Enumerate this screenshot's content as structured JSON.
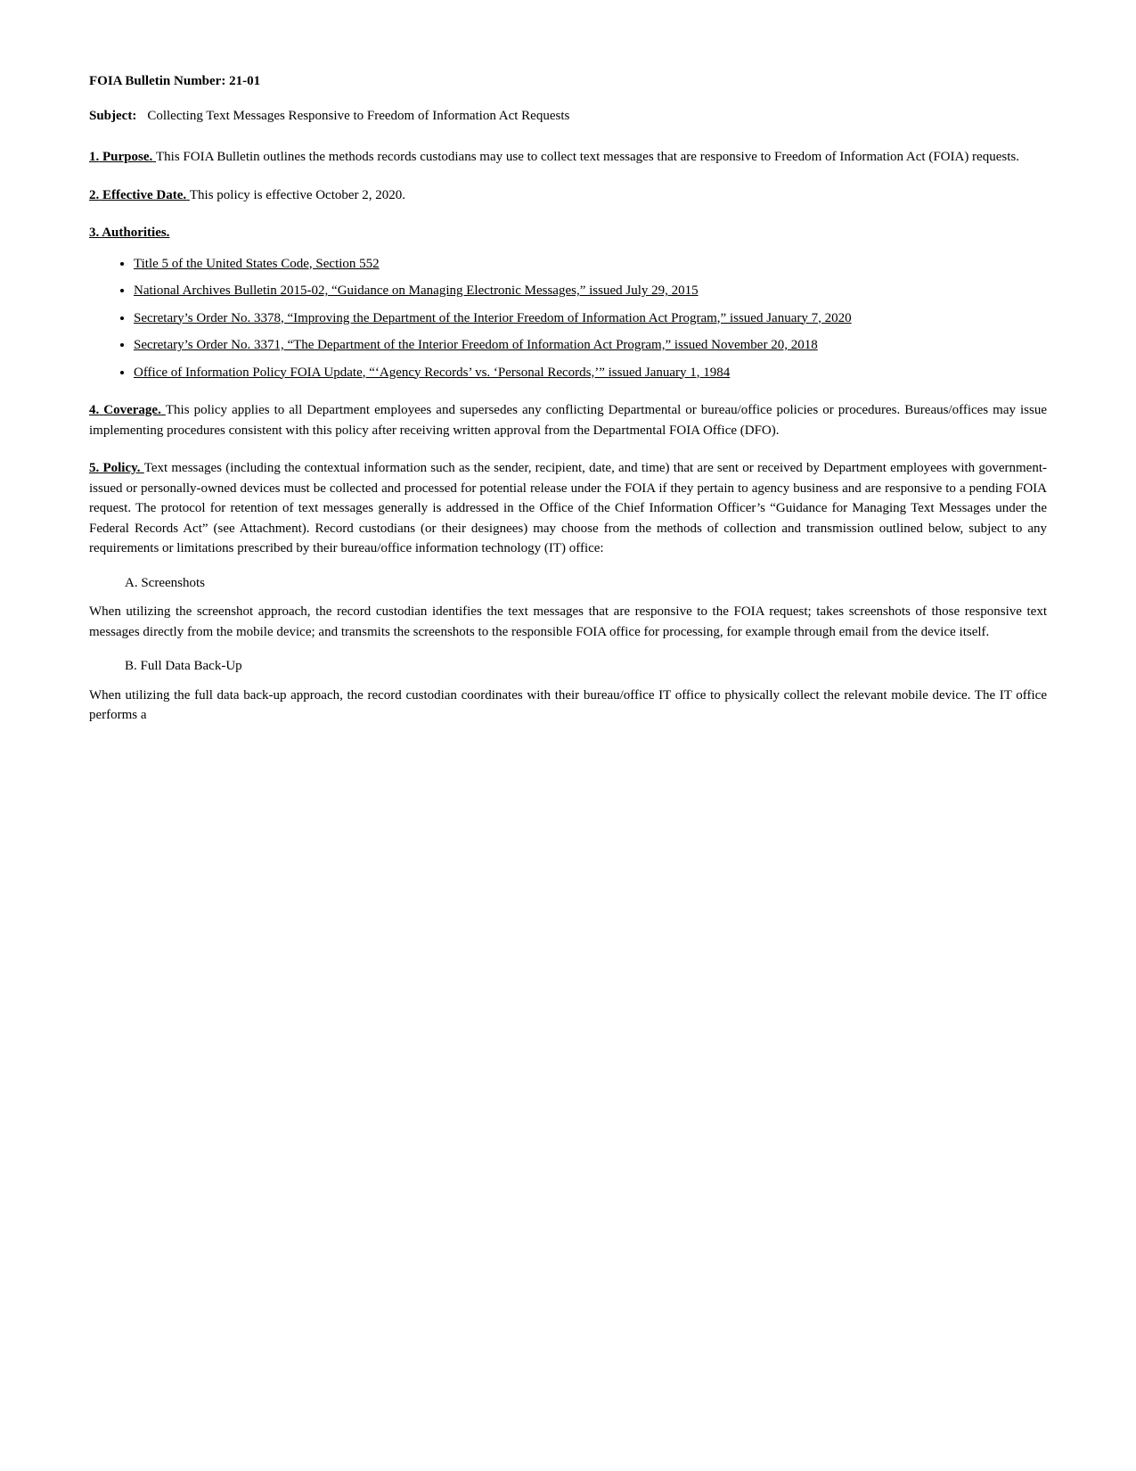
{
  "header": {
    "bulletin_label": "FOIA Bulletin Number:",
    "bulletin_number": "21-01",
    "subject_label": "Subject:",
    "subject_text": "Collecting Text Messages Responsive to Freedom of Information Act Requests"
  },
  "sections": [
    {
      "id": "purpose",
      "number": "1.",
      "heading": "Purpose.",
      "body": "This FOIA Bulletin outlines the methods records custodians may use to collect text messages that are responsive to Freedom of Information Act (FOIA) requests."
    },
    {
      "id": "effective-date",
      "number": "2.",
      "heading": "Effective Date.",
      "body": "This policy is effective October 2, 2020."
    },
    {
      "id": "authorities",
      "number": "3.",
      "heading": "Authorities.",
      "bullets": [
        "Title 5 of the United States Code, Section 552",
        "National Archives Bulletin 2015-02, “Guidance on Managing Electronic Messages,” issued July 29, 2015",
        "Secretary’s Order No. 3378, “Improving the Department of the Interior Freedom of Information Act Program,” issued January 7, 2020",
        "Secretary’s Order No. 3371, “The Department of the Interior Freedom of Information Act Program,” issued November 20, 2018",
        "Office of Information Policy FOIA Update, “‘Agency Records’ vs. ‘Personal Records,’” issued January 1, 1984"
      ]
    },
    {
      "id": "coverage",
      "number": "4.",
      "heading": "Coverage.",
      "body": "This policy applies to all Department employees and supersedes any conflicting Departmental or bureau/office policies or procedures.  Bureaus/offices may issue implementing procedures consistent with this policy after receiving written approval from the Departmental FOIA Office (DFO)."
    },
    {
      "id": "policy",
      "number": "5.",
      "heading": "Policy.",
      "body": "Text messages (including the contextual information such as the sender, recipient, date, and time) that are sent or received by Department employees with government-issued or personally-owned devices must be collected and processed for potential release under the FOIA if they pertain to agency business and are responsive to a pending FOIA request.  The protocol for retention of text messages generally is addressed in the Office of the Chief Information Officer’s “Guidance for Managing Text Messages under the Federal Records Act” (see Attachment).  Record custodians (or their designees) may choose from the methods of collection and transmission outlined below, subject to any requirements or limitations prescribed by their bureau/office information technology (IT) office:"
    }
  ],
  "subsections": [
    {
      "id": "screenshots",
      "label": "A.  Screenshots",
      "body": "When utilizing the screenshot approach, the record custodian identifies the text messages that are responsive to the FOIA request; takes screenshots of those responsive text messages directly from the mobile device; and transmits the screenshots to the responsible FOIA office for processing, for example through email from the device itself."
    },
    {
      "id": "full-data-backup",
      "label": "B.  Full Data Back-Up",
      "body": "When utilizing the full data back-up approach, the record custodian coordinates with their bureau/office IT office to physically collect the relevant mobile device.  The IT office performs a"
    }
  ]
}
